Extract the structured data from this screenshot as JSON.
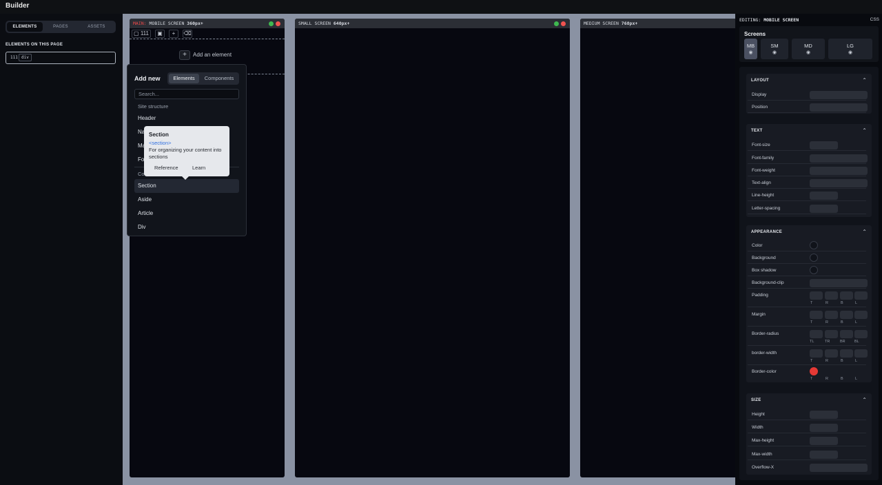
{
  "app": {
    "title": "Builder"
  },
  "left": {
    "tabs": [
      "ELEMENTS",
      "PAGES",
      "ASSETS"
    ],
    "section_label": "ELEMENTS ON THIS PAGE",
    "element": {
      "number": "111",
      "tag": "div"
    }
  },
  "frames": [
    {
      "prefix": "MAIN:",
      "name": "MOBILE SCREEN",
      "size": "360px+"
    },
    {
      "name": "SMALL SCREEN",
      "size": "640px+"
    },
    {
      "name": "MEDIUM SCREEN",
      "size": "768px+"
    }
  ],
  "toolbar": {
    "id_label": "111"
  },
  "canvas": {
    "add_element": "Add an element"
  },
  "popover": {
    "title": "Add new",
    "tabs": [
      "Elements",
      "Components"
    ],
    "search_placeholder": "Search...",
    "category": "Site structure",
    "items": [
      "Header",
      "Na",
      "Ma",
      "Fo",
      "Co",
      "Section",
      "Aside",
      "Article",
      "Div"
    ]
  },
  "tooltip": {
    "title": "Section",
    "tag": "<section>",
    "description": "For organizing your content into sections",
    "links": [
      "Reference",
      "Learn"
    ]
  },
  "right": {
    "editing_label": "EDITING:",
    "editing_value": "MOBILE SCREEN",
    "css": "CSS",
    "screens_title": "Screens",
    "screens": [
      "MB",
      "SM",
      "MD",
      "LG"
    ],
    "groups": {
      "layout": {
        "title": "LAYOUT",
        "props": [
          "Display",
          "Position"
        ]
      },
      "text": {
        "title": "TEXT",
        "props": [
          "Font-size",
          "Font-family",
          "Font-weight",
          "Text-align",
          "Line-height",
          "Letter-spacing"
        ]
      },
      "appearance": {
        "title": "APPEARANCE",
        "props": [
          "Color",
          "Background",
          "Box shadow",
          "Background-clip",
          "Padding",
          "Margin",
          "Border-radius",
          "border-width",
          "Border-color"
        ]
      },
      "size": {
        "title": "SIZE",
        "props": [
          "Height",
          "Width",
          "Max-height",
          "Max-width",
          "Overflow-X"
        ]
      }
    },
    "sides": [
      "T",
      "R",
      "B",
      "L"
    ],
    "corners": [
      "TL",
      "TR",
      "BR",
      "BL"
    ],
    "border_color_value": "#e53935"
  }
}
